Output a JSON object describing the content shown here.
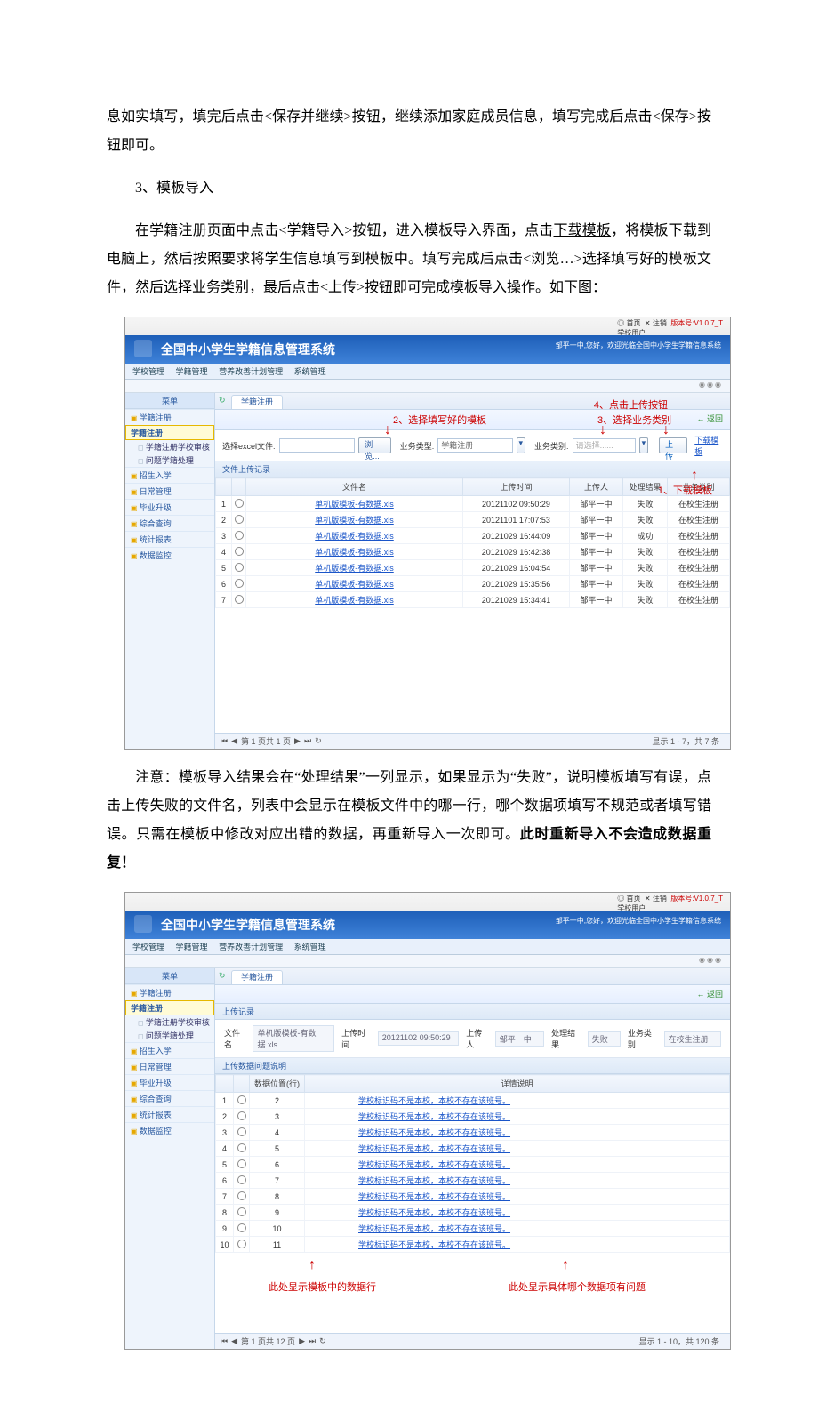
{
  "text": {
    "p1": "息如实填写，填完后点击<保存并继续>按钮，继续添加家庭成员信息，填写完成后点击<保存>按钮即可。",
    "h3": "3、模板导入",
    "p2a": "在学籍注册页面中点击<学籍导入>按钮，进入模板导入界面，点击",
    "p2link": "下载模板",
    "p2b": "，将模板下载到电脑上，然后按照要求将学生信息填写到模板中。填写完成后点击<浏览…>选择填写好的模板文件，然后选择业务类别，最后点击<上传>按钮即可完成模板导入操作。如下图：",
    "p3a": "注意：模板导入结果会在“处理结果”一列显示，如果显示为“失败”，说明模板填写有误，点击上传失败的文件名，列表中会显示在模板文件中的哪一行，哪个数据项填写不规范或者填写错误。只需在模板中修改对应出错的数据，再重新导入一次即可。",
    "p3b": "此时重新导入不会造成数据重复！"
  },
  "app": {
    "title": "全国中小学生学籍信息管理系统",
    "top_home": "首页",
    "top_logout": "注销",
    "top_ver": "版本号:V1.0.7_T",
    "top_role": "学校用户",
    "welcome": "邹平一中,您好，欢迎光临全国中小学生学籍信息系统",
    "circles": "◉◉◉",
    "menubar": {
      "m1": "学校管理",
      "m2": "学籍管理",
      "m3": "营养改善计划管理",
      "m4": "系统管理"
    },
    "sidebar": {
      "hdr": "菜单",
      "items": [
        {
          "t": "学籍注册",
          "cls": "cat folder",
          "bold": false
        },
        {
          "t": "学籍注册",
          "cls": "cat sel",
          "bold": true
        },
        {
          "t": "学籍注册学校审核",
          "cls": "sub1 page"
        },
        {
          "t": "问题学籍处理",
          "cls": "sub1 page"
        },
        {
          "t": "招生入学",
          "cls": "cat folder"
        },
        {
          "t": "日常管理",
          "cls": "cat folder"
        },
        {
          "t": "毕业升级",
          "cls": "cat folder"
        },
        {
          "t": "综合查询",
          "cls": "cat folder"
        },
        {
          "t": "统计报表",
          "cls": "cat folder"
        },
        {
          "t": "数据监控",
          "cls": "cat folder"
        }
      ]
    },
    "tab": "学籍注册",
    "back": "← 返回"
  },
  "shot1": {
    "annots": {
      "a2": "2、选择填写好的模板",
      "a3": "3、选择业务类别",
      "a4": "4、点击上传按钮",
      "a1": "1、下载模板"
    },
    "form": {
      "excel_lbl": "选择excel文件:",
      "browse": "浏览...",
      "biztype_lbl": "业务类型:",
      "biztype_val": "学籍注册",
      "bizcat_lbl": "业务类别:",
      "bizcat_ph": "请选择......",
      "upload": "上  传",
      "download": "下载模板"
    },
    "section": "文件上传记录",
    "columns": [
      "",
      "",
      "文件名",
      "上传时间",
      "上传人",
      "处理结果",
      "业务类别"
    ],
    "rows": [
      {
        "n": "1",
        "f": "单机版模板-有数据.xls",
        "t": "20121102 09:50:29",
        "u": "邹平一中",
        "r": "失败",
        "c": "在校生注册"
      },
      {
        "n": "2",
        "f": "单机版模板-有数据.xls",
        "t": "20121101 17:07:53",
        "u": "邹平一中",
        "r": "失败",
        "c": "在校生注册"
      },
      {
        "n": "3",
        "f": "单机版模板-有数据.xls",
        "t": "20121029 16:44:09",
        "u": "邹平一中",
        "r": "成功",
        "c": "在校生注册"
      },
      {
        "n": "4",
        "f": "单机版模板-有数据.xls",
        "t": "20121029 16:42:38",
        "u": "邹平一中",
        "r": "失败",
        "c": "在校生注册"
      },
      {
        "n": "5",
        "f": "单机版模板-有数据.xls",
        "t": "20121029 16:04:54",
        "u": "邹平一中",
        "r": "失败",
        "c": "在校生注册"
      },
      {
        "n": "6",
        "f": "单机版模板-有数据.xls",
        "t": "20121029 15:35:56",
        "u": "邹平一中",
        "r": "失败",
        "c": "在校生注册"
      },
      {
        "n": "7",
        "f": "单机版模板-有数据.xls",
        "t": "20121029 15:34:41",
        "u": "邹平一中",
        "r": "失败",
        "c": "在校生注册"
      }
    ],
    "pager": {
      "left": "第  1  页共 1 页",
      "right": "显示 1 - 7，共 7 条"
    }
  },
  "shot2": {
    "section1": "上传记录",
    "rec": {
      "c_file": "文件名",
      "v_file": "单机版模板-有数据.xls",
      "c_time": "上传时间",
      "v_time": "20121102 09:50:29",
      "c_user": "上传人",
      "v_user": "邹平一中",
      "c_res": "处理结果",
      "v_res": "失败",
      "c_cat": "业务类别",
      "v_cat": "在校生注册"
    },
    "section2": "上传数据问题说明",
    "col_pos": "数据位置(行)",
    "col_err": "详情说明",
    "rows": [
      {
        "n": "1",
        "p": "2"
      },
      {
        "n": "2",
        "p": "3"
      },
      {
        "n": "3",
        "p": "4"
      },
      {
        "n": "4",
        "p": "5"
      },
      {
        "n": "5",
        "p": "6"
      },
      {
        "n": "6",
        "p": "7"
      },
      {
        "n": "7",
        "p": "8"
      },
      {
        "n": "8",
        "p": "9"
      },
      {
        "n": "9",
        "p": "10"
      },
      {
        "n": "10",
        "p": "11"
      }
    ],
    "errmsg": "学校标识码不是本校，本校不存在该班号。",
    "legend_left": "此处显示模板中的数据行",
    "legend_right": "此处显示具体哪个数据项有问题",
    "pager": {
      "left": "第  1  页共 12 页",
      "right": "显示 1 - 10，共 120 条"
    }
  }
}
